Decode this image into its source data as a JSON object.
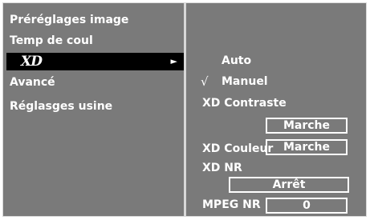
{
  "menu": {
    "items": [
      {
        "label": "Préréglages image"
      },
      {
        "label": "Temp de coul"
      },
      {
        "label": "XD",
        "arrow": "►"
      },
      {
        "label": "Avancé"
      },
      {
        "label": "Réglasges usine"
      }
    ],
    "selected_index": 2
  },
  "submenu": {
    "options": [
      {
        "label": "Auto"
      },
      {
        "label": "Manuel",
        "check": "√"
      }
    ],
    "xd_contraste": {
      "label": "XD Contraste",
      "value": "Marche"
    },
    "xd_couleur": {
      "label": "XD Couleur",
      "value": "Marche"
    },
    "xd_nr": {
      "label": "XD NR",
      "value": "Arrêt"
    },
    "mpeg_nr": {
      "label": "MPEG NR",
      "value": "0"
    }
  },
  "colors": {
    "panel": "#7a7a7a",
    "border": "#d8d8d8",
    "selected_bg": "#000000",
    "text": "#ffffff"
  }
}
